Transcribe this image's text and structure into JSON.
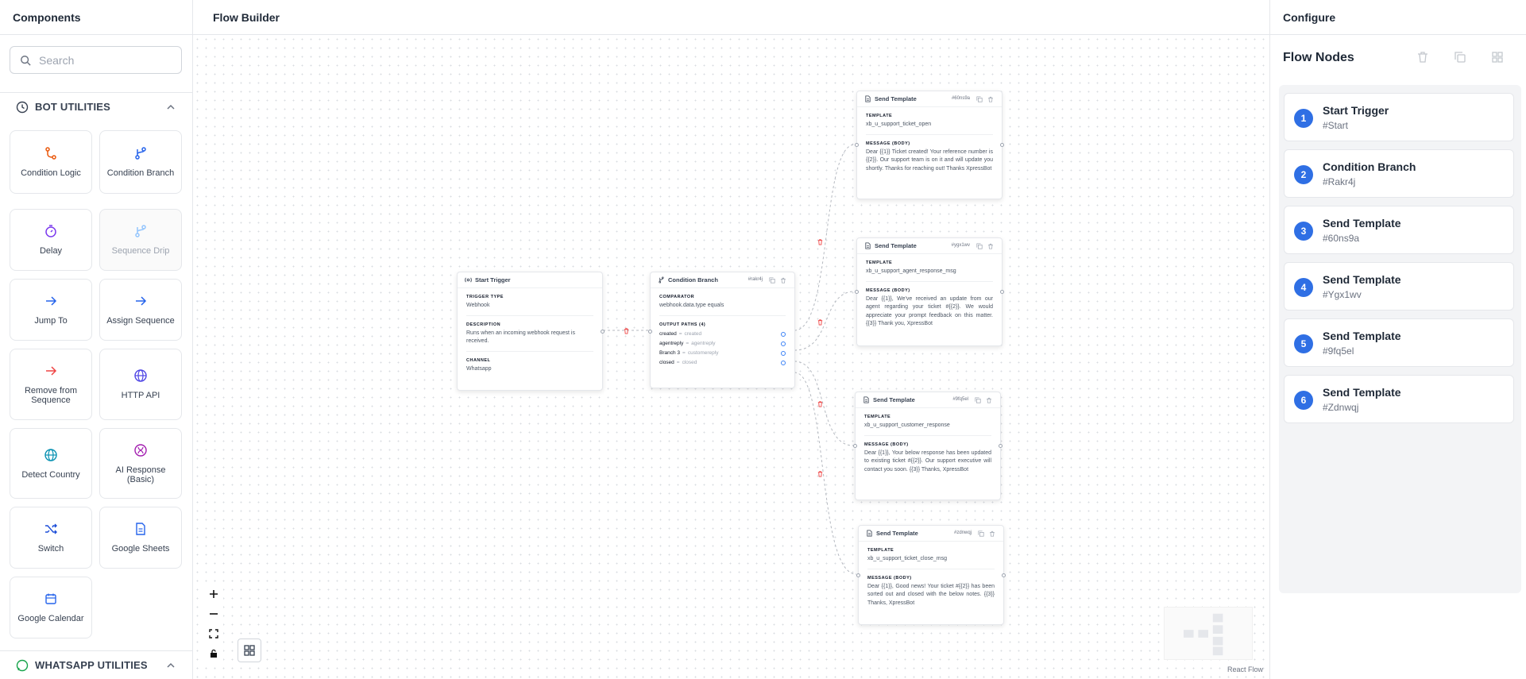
{
  "left_panel": {
    "title": "Components",
    "search_placeholder": "Search",
    "bot_utilities": {
      "title": "BOT UTILITIES",
      "items": [
        {
          "label": "Condition Logic",
          "icon": "condition-logic-icon"
        },
        {
          "label": "Condition Branch",
          "icon": "branch-icon"
        },
        {
          "label": "Delay",
          "icon": "timer-icon"
        },
        {
          "label": "Sequence Drip",
          "icon": "branch-icon",
          "disabled": true
        },
        {
          "label": "Jump To",
          "icon": "arrow-right-icon"
        },
        {
          "label": "Assign Sequence",
          "icon": "arrow-right-icon"
        },
        {
          "label": "Remove from Sequence",
          "icon": "arrow-right-icon"
        },
        {
          "label": "HTTP API",
          "icon": "globe-icon"
        },
        {
          "label": "Detect Country",
          "icon": "globe-icon"
        },
        {
          "label": "AI Response (Basic)",
          "icon": "ai-icon"
        },
        {
          "label": "Switch",
          "icon": "shuffle-icon"
        },
        {
          "label": "Google Sheets",
          "icon": "sheet-icon"
        },
        {
          "label": "Google Calendar",
          "icon": "calendar-icon"
        }
      ]
    },
    "whatsapp_utilities": {
      "title": "WHATSAPP UTILITIES"
    }
  },
  "center": {
    "title": "Flow Builder",
    "attribution": "React Flow",
    "nodes": {
      "start": {
        "title": "Start Trigger",
        "trigger_type_label": "TRIGGER TYPE",
        "trigger_type": "Webhook",
        "description_label": "DESCRIPTION",
        "description": "Runs when an incoming webhook request is received.",
        "channel_label": "CHANNEL",
        "channel": "Whatsapp"
      },
      "condition": {
        "title": "Condition Branch",
        "id": "#rakr4j",
        "comparator_label": "COMPARATOR",
        "comparator": "webhook.data.type equals",
        "output_label": "OUTPUT PATHS (4)",
        "paths": [
          {
            "key": "created",
            "value": "created"
          },
          {
            "key": "agentreply",
            "value": "agentreply"
          },
          {
            "key": "Branch 3",
            "value": "customereply"
          },
          {
            "key": "closed",
            "value": "closed"
          }
        ]
      },
      "t1": {
        "title": "Send Template",
        "id": "#60ns9a",
        "template_label": "TEMPLATE",
        "template": "xb_u_support_ticket_open",
        "body_label": "MESSAGE (BODY)",
        "body": "Dear {{1}} Ticket created! Your reference number is {{2}}. Our support team is on it and will update you shortly. Thanks for reaching out! Thanks XpressBot"
      },
      "t2": {
        "title": "Send Template",
        "id": "#ygx1wv",
        "template_label": "TEMPLATE",
        "template": "xb_u_support_agent_response_msg",
        "body_label": "MESSAGE (BODY)",
        "body": "Dear {{1}}, We've received an update from our agent regarding your ticket #{{2}}. We would appreciate your prompt feedback on this matter. {{3}} Thank you, XpressBot"
      },
      "t3": {
        "title": "Send Template",
        "id": "#9fq5el",
        "template_label": "TEMPLATE",
        "template": "xb_u_support_customer_response",
        "body_label": "MESSAGE (BODY)",
        "body": "Dear {{1}}, Your below response has been updated to existing ticket #{{2}}. Our support executive will contact you soon. {{3}} Thanks, XpressBot"
      },
      "t4": {
        "title": "Send Template",
        "id": "#zdnwqj",
        "template_label": "TEMPLATE",
        "template": "xb_u_support_ticket_close_msg",
        "body_label": "MESSAGE (BODY)",
        "body": "Dear {{1}}, Good news! Your ticket #{{2}} has been sorted out and closed with the below notes. {{3}} Thanks, XpressBot"
      }
    }
  },
  "right_panel": {
    "title": "Configure",
    "section_title": "Flow Nodes",
    "nodes": [
      {
        "num": "1",
        "name": "Start Trigger",
        "id": "#Start"
      },
      {
        "num": "2",
        "name": "Condition Branch",
        "id": "#Rakr4j"
      },
      {
        "num": "3",
        "name": "Send Template",
        "id": "#60ns9a"
      },
      {
        "num": "4",
        "name": "Send Template",
        "id": "#Ygx1wv"
      },
      {
        "num": "5",
        "name": "Send Template",
        "id": "#9fq5el"
      },
      {
        "num": "6",
        "name": "Send Template",
        "id": "#Zdnwqj"
      }
    ]
  },
  "colors": {
    "accent": "#2f6fe4",
    "danger": "#ef4444",
    "border": "#e5e7eb"
  }
}
